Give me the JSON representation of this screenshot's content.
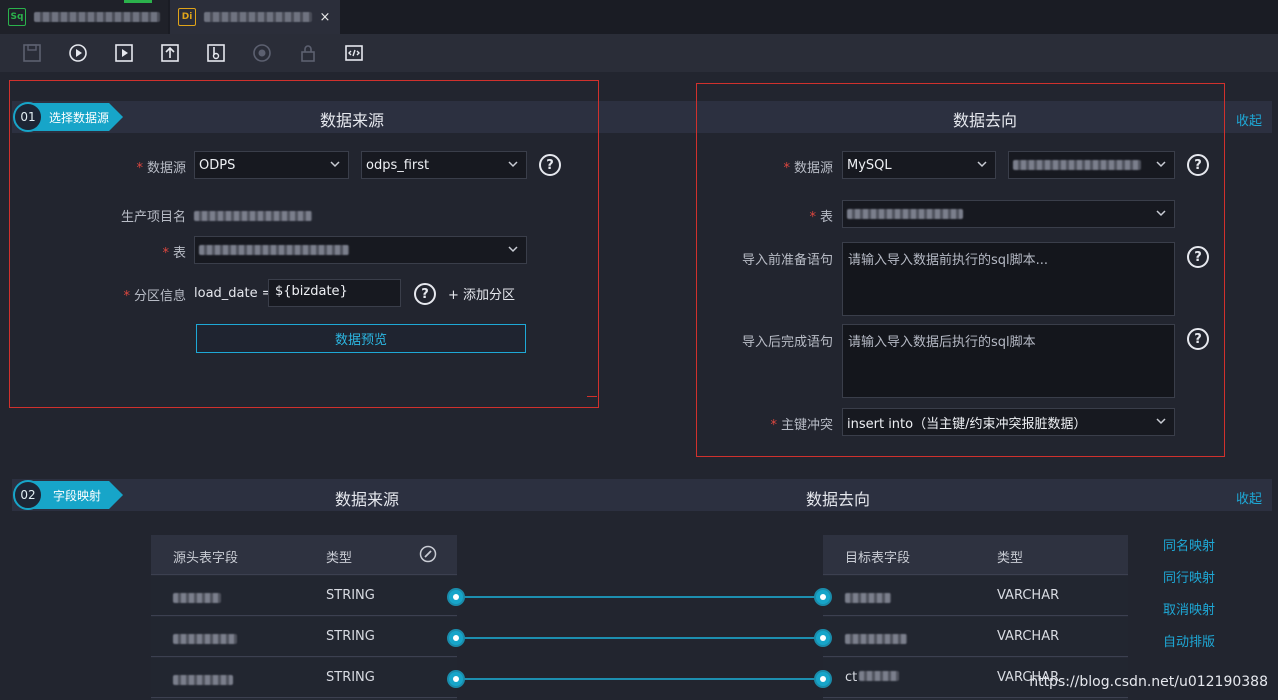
{
  "tabs": [
    {
      "icon": "Sq",
      "title_blurred": true
    },
    {
      "icon": "Di",
      "title_blurred": true,
      "close": "×"
    }
  ],
  "toolbar": {
    "icons": [
      "save-icon",
      "run-icon",
      "run-params-icon",
      "submit-icon",
      "publish-icon",
      "stop-icon",
      "lock-icon",
      "code-icon"
    ]
  },
  "section1": {
    "step_num": "01",
    "step_label": "选择数据源",
    "source_title": "数据来源",
    "target_title": "数据去向",
    "collapse": "收起",
    "source": {
      "datasource_label": "数据源",
      "datasource_type": "ODPS",
      "datasource_name": "odps_first",
      "project_label": "生产项目名",
      "table_label": "表",
      "partition_label": "分区信息",
      "partition_key": "load_date =",
      "partition_value": "${bizdate}",
      "add_partition": "+ 添加分区",
      "preview_button": "数据预览"
    },
    "target": {
      "datasource_label": "数据源",
      "datasource_type": "MySQL",
      "table_label": "表",
      "pre_sql_label": "导入前准备语句",
      "pre_sql_placeholder": "请输入导入数据前执行的sql脚本...",
      "post_sql_label": "导入后完成语句",
      "post_sql_placeholder": "请输入导入数据后执行的sql脚本",
      "conflict_label": "主键冲突",
      "conflict_value": "insert into（当主键/约束冲突报脏数据）"
    }
  },
  "section2": {
    "step_num": "02",
    "step_label": "字段映射",
    "source_title": "数据来源",
    "target_title": "数据去向",
    "collapse": "收起",
    "source_headers": [
      "源头表字段",
      "类型"
    ],
    "target_headers": [
      "目标表字段",
      "类型"
    ],
    "source_rows": [
      {
        "type": "STRING"
      },
      {
        "type": "STRING"
      },
      {
        "type": "STRING"
      }
    ],
    "target_rows": [
      {
        "type": "VARCHAR"
      },
      {
        "type": "VARCHAR"
      },
      {
        "prefix": "ct",
        "type": "VARCHAR"
      }
    ],
    "actions": [
      "同名映射",
      "同行映射",
      "取消映射",
      "自动排版"
    ]
  },
  "watermark": "https://blog.csdn.net/u012190388"
}
